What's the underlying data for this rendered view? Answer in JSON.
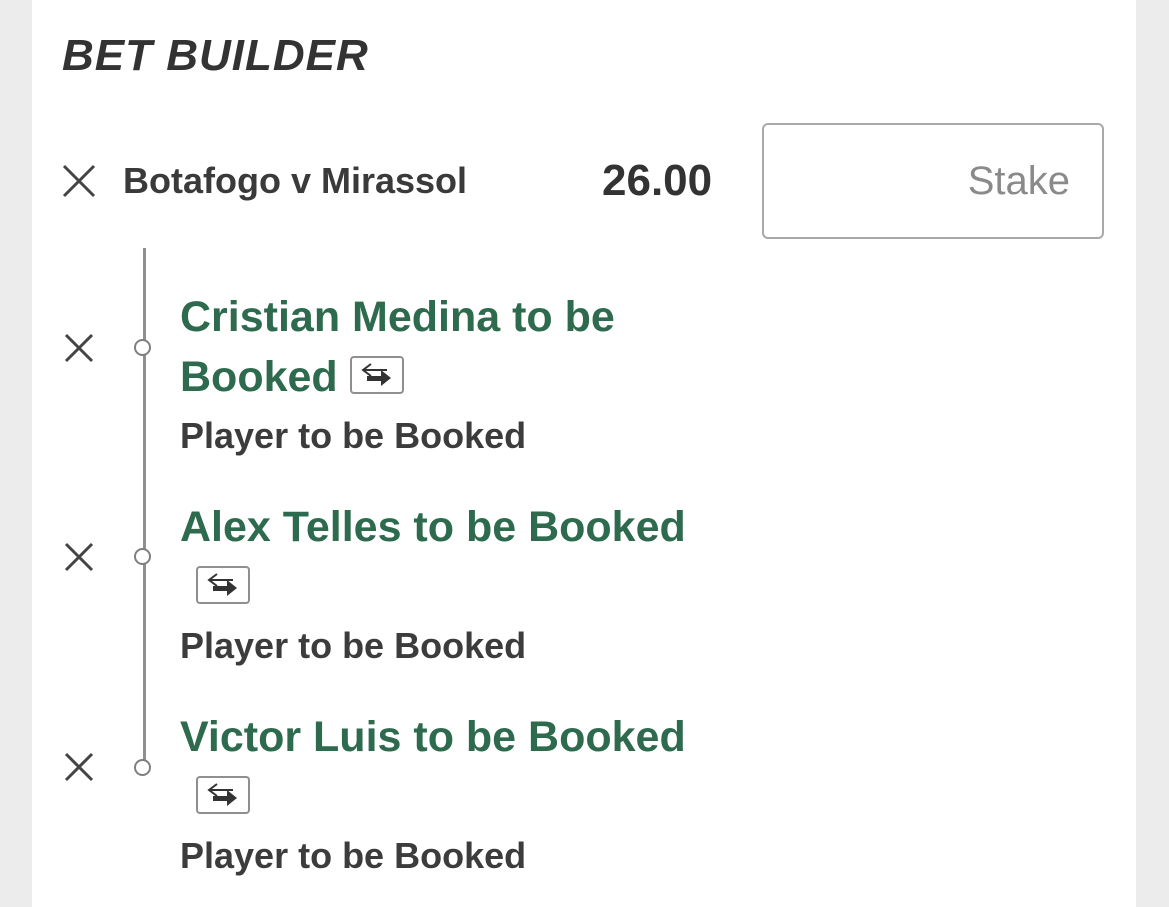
{
  "header": {
    "title": "BET BUILDER"
  },
  "bet": {
    "match": "Botafogo v Mirassol",
    "odds": "26.00",
    "stake_placeholder": "Stake"
  },
  "selections": [
    {
      "name": "Cristian Medina to be Booked",
      "market": "Player to be Booked"
    },
    {
      "name": "Alex Telles to be Booked",
      "market": "Player to be Booked"
    },
    {
      "name": "Victor Luis to be Booked",
      "market": "Player to be Booked"
    }
  ],
  "icons": {
    "remove": "close-icon",
    "swap": "swap-arrows-icon"
  },
  "colors": {
    "selection_text": "#2e6b4e",
    "text_dark": "#333333",
    "border": "#a9a9a9"
  }
}
